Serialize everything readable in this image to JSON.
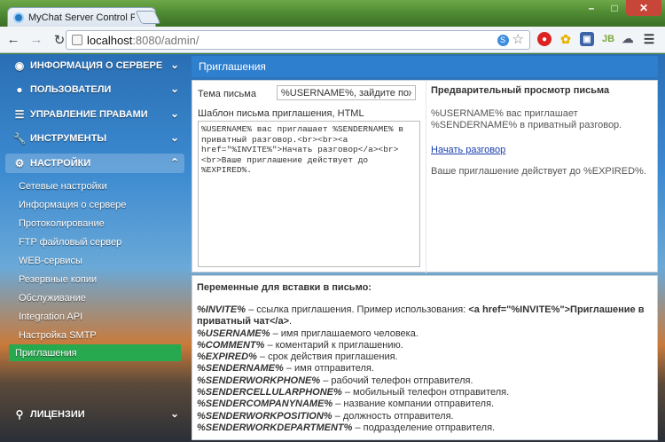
{
  "browser": {
    "tab_title": "MyChat Server Control Pa",
    "tab_close": "×",
    "url_host": "localhost",
    "url_path": ":8080/admin/",
    "window_buttons": [
      "–",
      "□",
      "✕"
    ]
  },
  "sidebar": {
    "sections": [
      {
        "label": "ИНФОРМАЦИЯ О СЕРВЕРЕ",
        "icon": "globe-icon"
      },
      {
        "label": "ПОЛЬЗОВАТЕЛИ",
        "icon": "users-icon"
      },
      {
        "label": "УПРАВЛЕНИЕ ПРАВАМИ",
        "icon": "list-icon"
      },
      {
        "label": "ИНСТРУМЕНТЫ",
        "icon": "wrench-icon"
      },
      {
        "label": "НАСТРОЙКИ",
        "icon": "gears-icon"
      },
      {
        "label": "ЛИЦЕНЗИИ",
        "icon": "key-icon"
      }
    ],
    "settings_items": [
      "Сетевые настройки",
      "Информация о сервере",
      "Протоколирование",
      "FTP файловый сервер",
      "WEB-сервисы",
      "Резервные копии",
      "Обслуживание",
      "Integration API",
      "Настройка SMTP",
      "Приглашения"
    ],
    "active_item": "Приглашения"
  },
  "main": {
    "panel_title": "Приглашения",
    "subject_label": "Тема письма",
    "subject_value": "%USERNAME%, зайдите пож",
    "template_label": "Шаблон письма приглашения, HTML",
    "template_value": "%USERNAME% вас приглашает %SENDERNAME% в приватный разговор.<br><br><a href=\"%INVITE%\">Начать разговор</a><br><br>Ваше приглашение действует до %EXPIRED%.",
    "preview_title": "Предварительный просмотр письма",
    "preview_line1": "%USERNAME% вас приглашает %SENDERNAME% в приватный разговор.",
    "preview_link": "Начать разговор",
    "preview_line2": "Ваше приглашение действует до %EXPIRED%."
  },
  "variables": {
    "title": "Переменные для вставки в письмо:",
    "invite_code": "%INVITE%",
    "invite_desc": " – ссылка приглашения. Пример использования: ",
    "invite_example": "<a href=\"%INVITE%\">Приглашение в приватный чат</a>",
    "invite_end": ".",
    "items": [
      {
        "code": "%USERNAME%",
        "desc": " – имя приглашаемого человека."
      },
      {
        "code": "%COMMENT%",
        "desc": " – коментарий к приглашению."
      },
      {
        "code": "%EXPIRED%",
        "desc": " – срок действия приглашения."
      },
      {
        "code": "%SENDERNAME%",
        "desc": " – имя отправителя."
      },
      {
        "code": "%SENDERWORKPHONE%",
        "desc": " – рабочий телефон отправителя."
      },
      {
        "code": "%SENDERCELLULARPHONE%",
        "desc": " – мобильный телефон отправителя."
      },
      {
        "code": "%SENDERCOMPANYNAME%",
        "desc": " – название компании отправителя."
      },
      {
        "code": "%SENDERWORKPOSITION%",
        "desc": " – должность отправителя."
      },
      {
        "code": "%SENDERWORKDEPARTMENT%",
        "desc": " – подразделение отправителя."
      }
    ]
  }
}
